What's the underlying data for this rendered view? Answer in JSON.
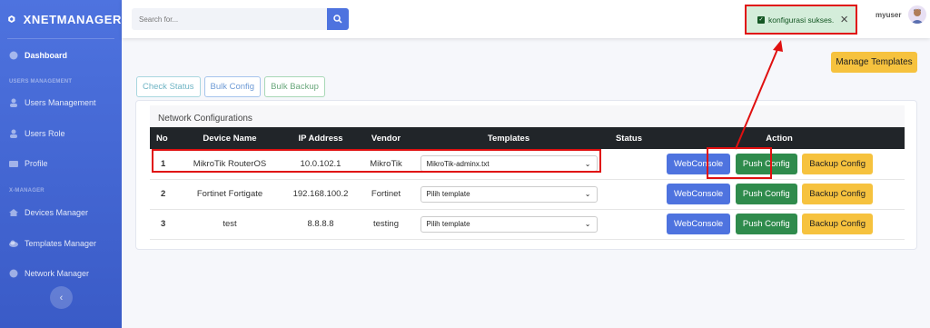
{
  "app": {
    "brand": "XNETMANAGER"
  },
  "sidebar": {
    "items": [
      {
        "label": "Dashboard"
      },
      {
        "label": "Users Management"
      },
      {
        "label": "Users Role"
      },
      {
        "label": "Profile"
      },
      {
        "label": "Devices Manager"
      },
      {
        "label": "Templates Manager"
      },
      {
        "label": "Network Manager"
      }
    ],
    "headings": [
      "USERS MANAGEMENT",
      "X-MANAGER"
    ],
    "toggle": "‹"
  },
  "topbar": {
    "search_placeholder": "Search for...",
    "toast": "konfigurasi sukses.",
    "username": "myuser"
  },
  "actions": {
    "manage_templates": "Manage Templates",
    "check_status": "Check Status",
    "bulk_config": "Bulk Config",
    "bulk_backup": "Bulk Backup"
  },
  "card": {
    "title": "Network Configurations",
    "headers": [
      "No",
      "Device Name",
      "IP Address",
      "Vendor",
      "Templates",
      "Status",
      "Action"
    ],
    "rows": [
      {
        "no": "1",
        "device": "MikroTik RouterOS",
        "ip": "10.0.102.1",
        "vendor": "MikroTik",
        "template": "MikroTik-adminx.txt",
        "status": ""
      },
      {
        "no": "2",
        "device": "Fortinet Fortigate",
        "ip": "192.168.100.2",
        "vendor": "Fortinet",
        "template": "Pilih template",
        "status": ""
      },
      {
        "no": "3",
        "device": "test",
        "ip": "8.8.8.8",
        "vendor": "testing",
        "template": "Pilih template",
        "status": ""
      }
    ],
    "btn_webconsole": "WebConsole",
    "btn_push": "Push Config",
    "btn_backup": "Backup Config"
  },
  "colors": {
    "primary": "#4e73df",
    "success": "#2f8b4c",
    "warning": "#f6c23e",
    "highlight": "#e01010"
  }
}
